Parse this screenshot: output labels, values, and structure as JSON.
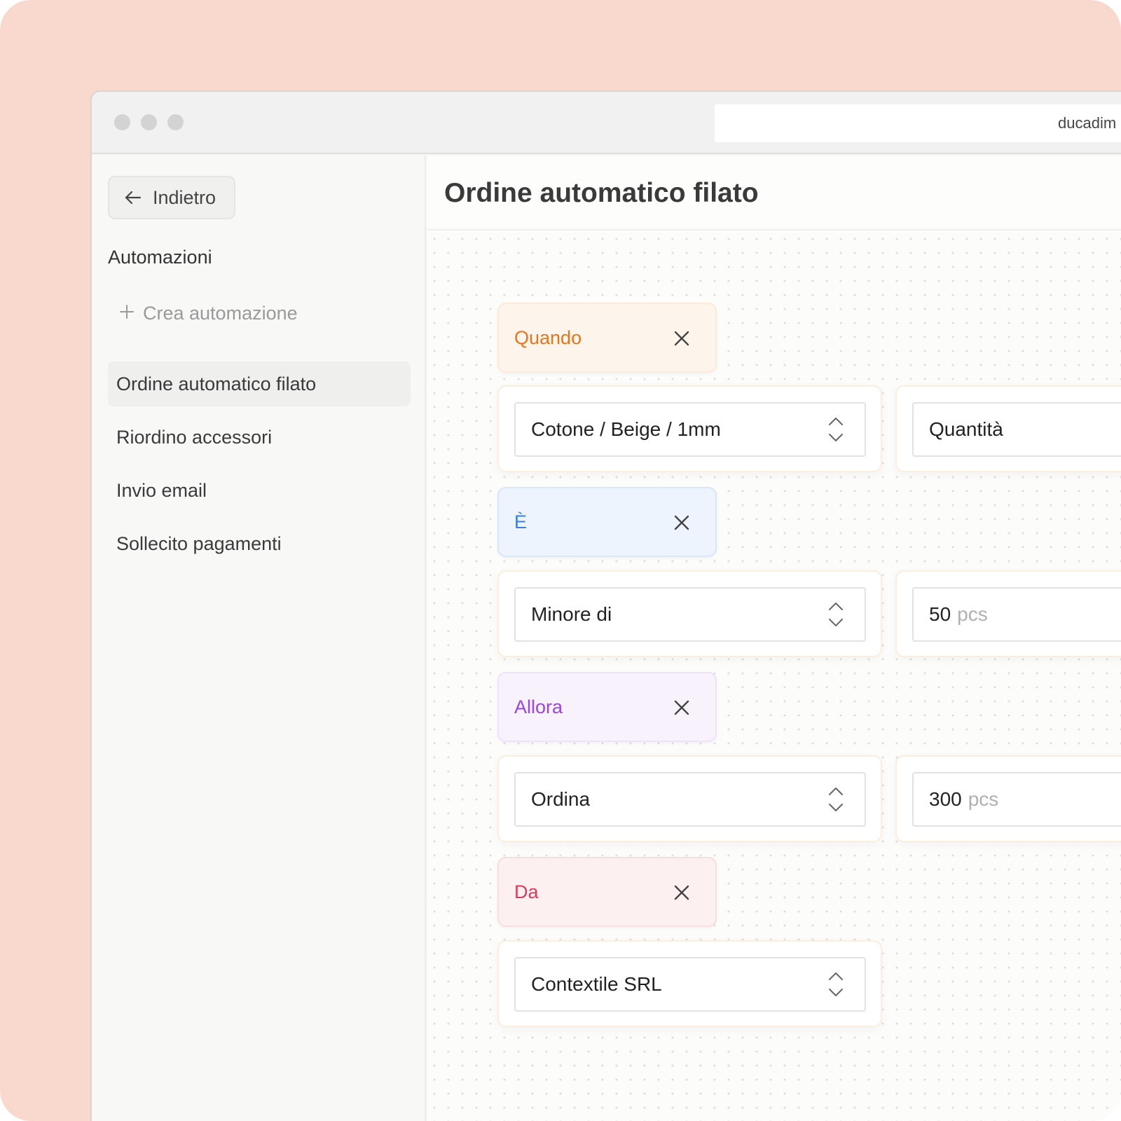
{
  "browser": {
    "url": "ducadim"
  },
  "sidebar": {
    "back_label": "Indietro",
    "section_title": "Automazioni",
    "create_label": "Crea automazione",
    "items": [
      {
        "label": "Ordine automatico filato",
        "active": true
      },
      {
        "label": "Riordino accessori",
        "active": false
      },
      {
        "label": "Invio email",
        "active": false
      },
      {
        "label": "Sollecito pagamenti",
        "active": false
      }
    ]
  },
  "main": {
    "title": "Ordine automatico filato"
  },
  "rules": {
    "when": {
      "label": "Quando",
      "select_value": "Cotone / Beige / 1mm",
      "field_value": "Quantità"
    },
    "is": {
      "label": "È",
      "select_value": "Minore di",
      "quantity": "50",
      "unit": "pcs"
    },
    "then": {
      "label": "Allora",
      "select_value": "Ordina",
      "quantity": "300",
      "unit": "pcs"
    },
    "from": {
      "label": "Da",
      "select_value": "Contextile SRL"
    }
  },
  "colors": {
    "background": "#f9d8cd",
    "when": "#e8761c",
    "is": "#3a7fd9",
    "then": "#9b45e0",
    "from": "#e03a5a"
  },
  "icons": {
    "back": "arrow-left-icon",
    "create": "plus-icon",
    "remove": "close-icon",
    "select": "chevron-up-down-icon"
  }
}
